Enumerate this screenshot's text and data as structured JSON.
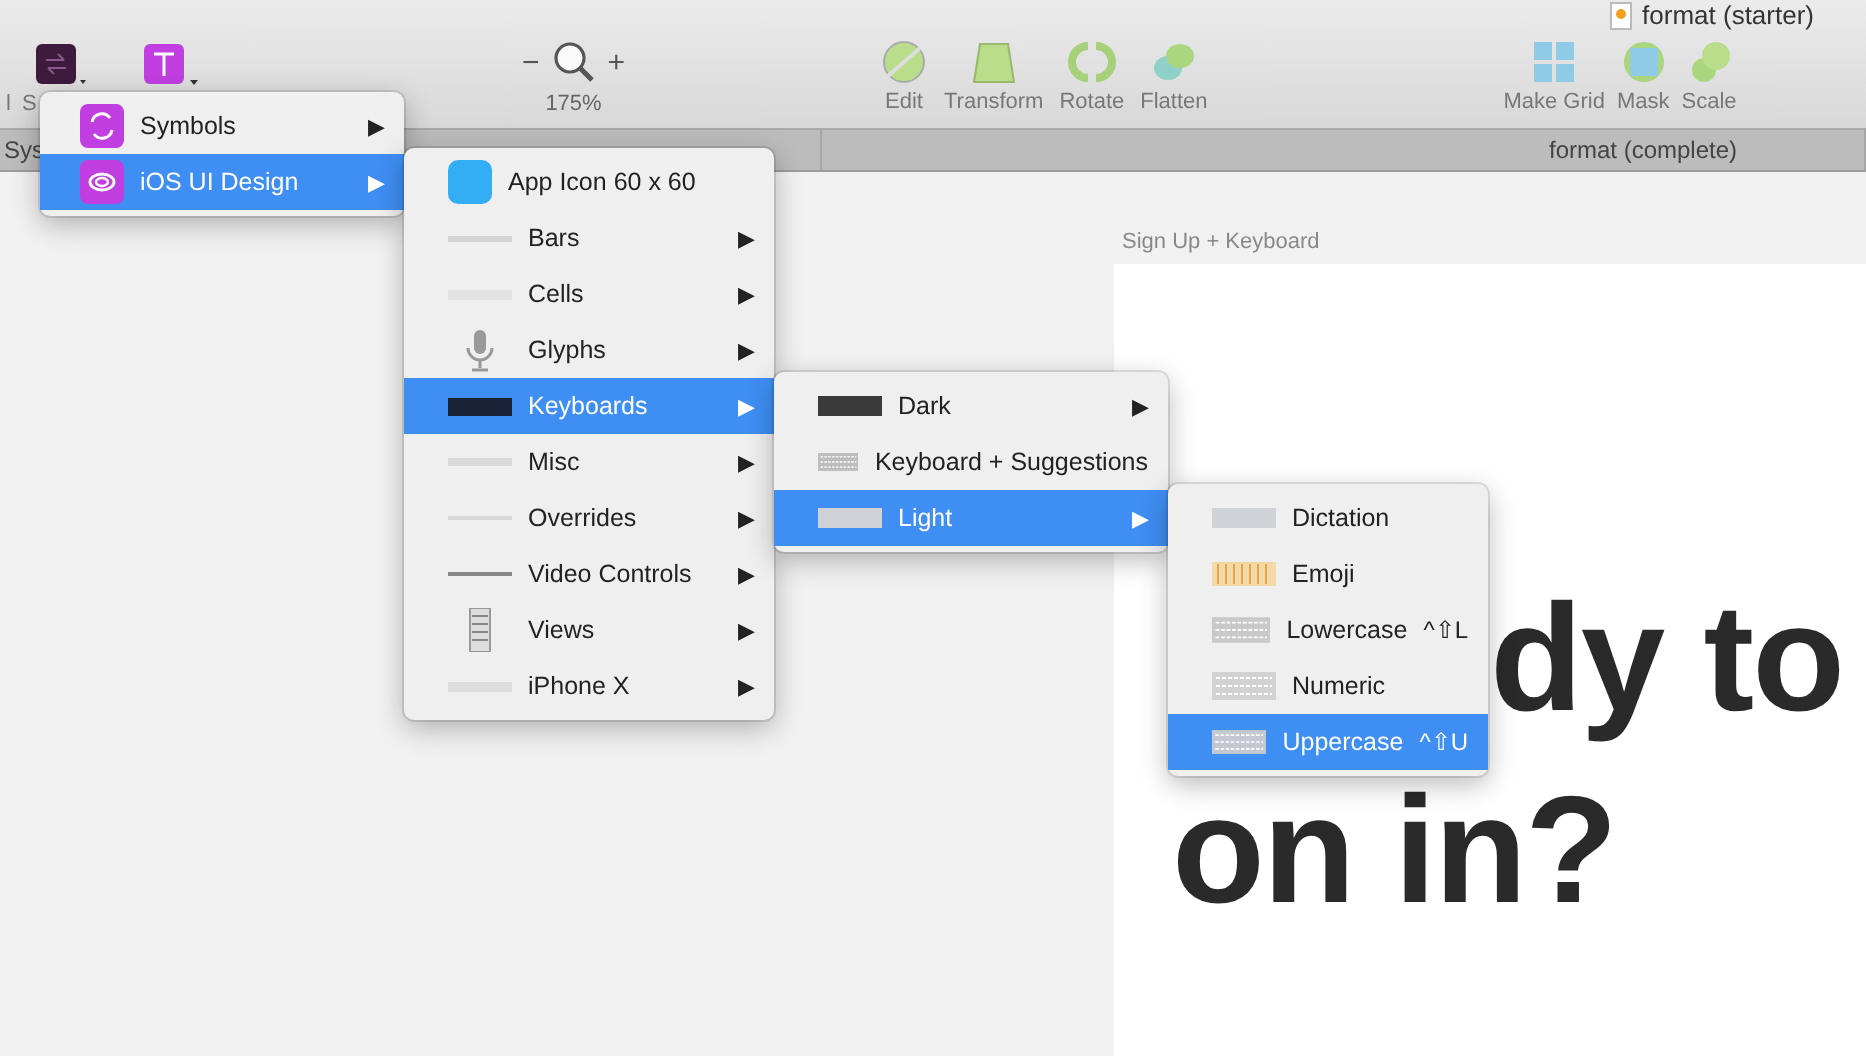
{
  "window": {
    "title": "format (starter)"
  },
  "toolbar": {
    "cut_labels": [
      "l",
      "S"
    ],
    "zoom": {
      "minus": "−",
      "plus": "+",
      "reading": "175%"
    },
    "tools": [
      {
        "label": "Edit"
      },
      {
        "label": "Transform"
      },
      {
        "label": "Rotate"
      },
      {
        "label": "Flatten"
      }
    ],
    "right_tools": [
      {
        "label": "Make Grid"
      },
      {
        "label": "Mask"
      },
      {
        "label": "Scale"
      }
    ]
  },
  "tabs": [
    {
      "label": "Sys",
      "selected": false
    },
    {
      "label": "format (complete)",
      "selected": false
    }
  ],
  "canvas": {
    "artboard_title": "Sign Up + Keyboard",
    "lines": [
      "dy to",
      "on in?"
    ]
  },
  "menus": [
    {
      "items": [
        {
          "label": "Symbols",
          "selected": false,
          "submenu": "▶"
        },
        {
          "label": "iOS UI Design",
          "selected": true,
          "submenu": "▶"
        }
      ]
    },
    {
      "items": [
        {
          "label": "App Icon 60 x 60",
          "selected": false
        },
        {
          "label": "Bars",
          "selected": false,
          "submenu": "▶"
        },
        {
          "label": "Cells",
          "selected": false,
          "submenu": "▶"
        },
        {
          "label": "Glyphs",
          "selected": false,
          "submenu": "▶"
        },
        {
          "label": "Keyboards",
          "selected": true,
          "submenu": "▶"
        },
        {
          "label": "Misc",
          "selected": false,
          "submenu": "▶"
        },
        {
          "label": "Overrides",
          "selected": false,
          "submenu": "▶"
        },
        {
          "label": "Video Controls",
          "selected": false,
          "submenu": "▶"
        },
        {
          "label": "Views",
          "selected": false,
          "submenu": "▶"
        },
        {
          "label": "iPhone X",
          "selected": false,
          "submenu": "▶"
        }
      ]
    },
    {
      "items": [
        {
          "label": "Dark",
          "selected": false,
          "submenu": "▶"
        },
        {
          "label": "Keyboard + Suggestions",
          "selected": false
        },
        {
          "label": "Light",
          "selected": true,
          "submenu": "▶"
        }
      ]
    },
    {
      "items": [
        {
          "label": "Dictation",
          "selected": false
        },
        {
          "label": "Emoji",
          "selected": false
        },
        {
          "label": "Lowercase",
          "selected": false,
          "shortcut": "^⇧L"
        },
        {
          "label": "Numeric",
          "selected": false
        },
        {
          "label": "Uppercase",
          "selected": true,
          "shortcut": "^⇧U"
        }
      ]
    }
  ]
}
